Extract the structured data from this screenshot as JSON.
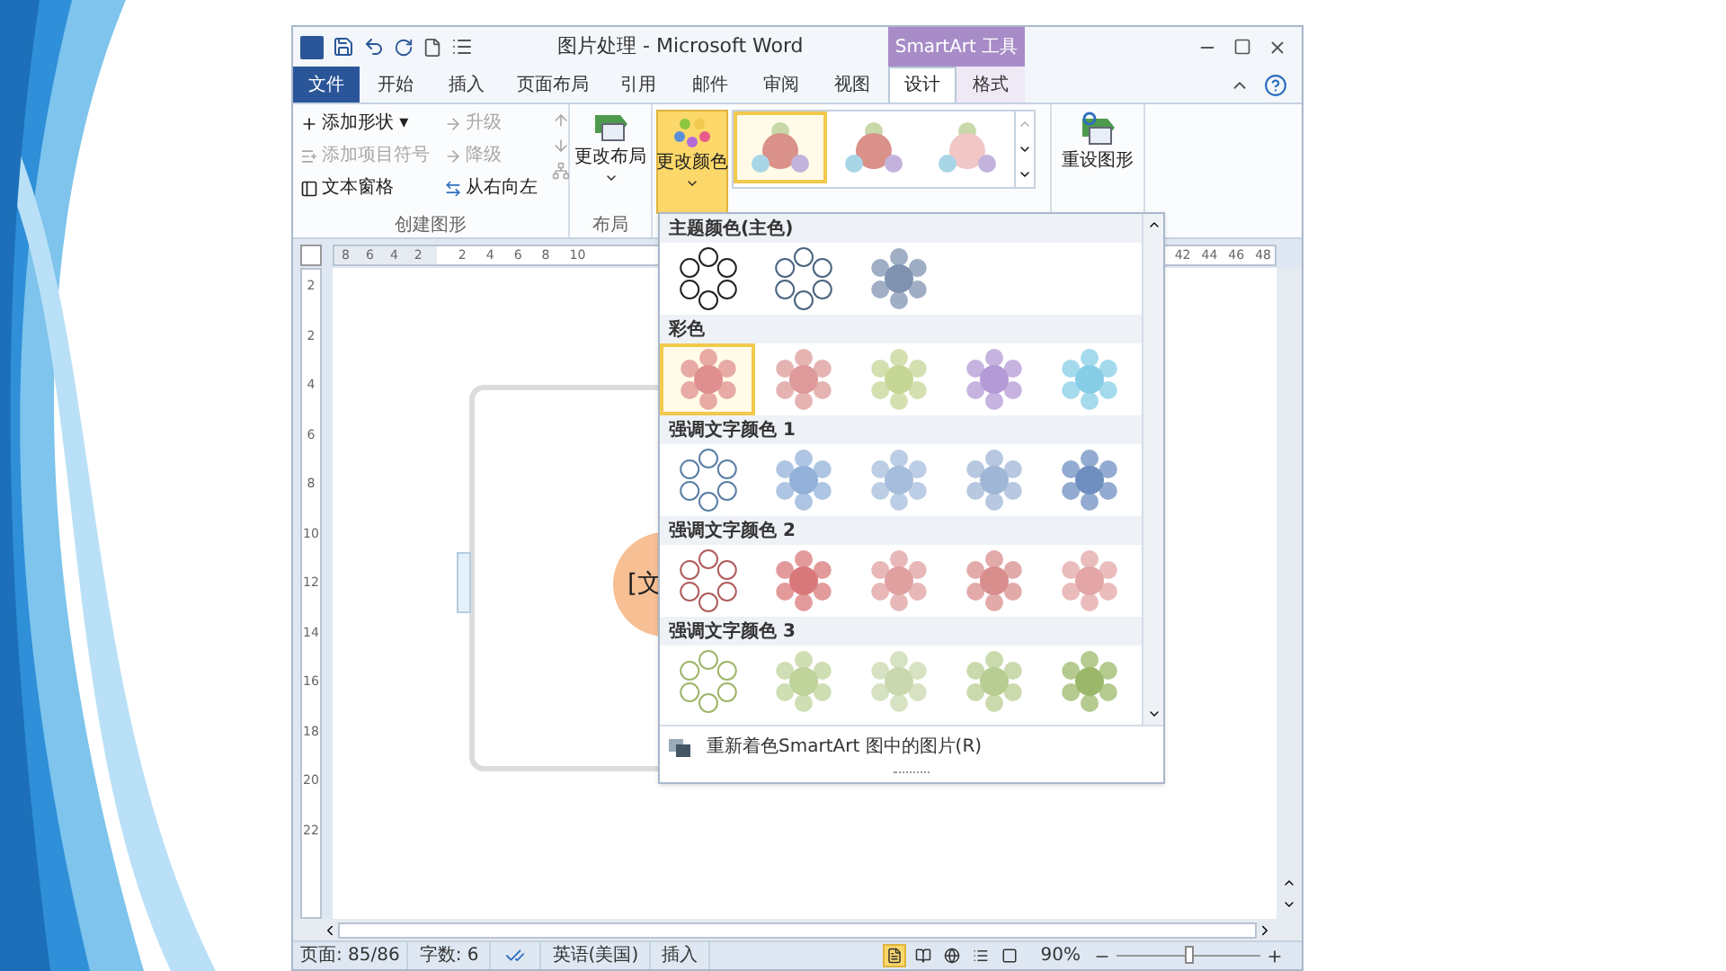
{
  "window": {
    "title": "图片处理 - Microsoft Word",
    "context_label": "SmartArt 工具"
  },
  "tabs": [
    {
      "label": "文件",
      "kind": "file",
      "selected": false
    },
    {
      "label": "开始",
      "kind": "tab",
      "selected": false
    },
    {
      "label": "插入",
      "kind": "tab",
      "selected": false
    },
    {
      "label": "页面布局",
      "kind": "tab",
      "selected": false
    },
    {
      "label": "引用",
      "kind": "tab",
      "selected": false
    },
    {
      "label": "邮件",
      "kind": "tab",
      "selected": false
    },
    {
      "label": "审阅",
      "kind": "tab",
      "selected": false
    },
    {
      "label": "视图",
      "kind": "tab",
      "selected": false
    },
    {
      "label": "设计",
      "kind": "context",
      "selected": true
    },
    {
      "label": "格式",
      "kind": "context",
      "selected": false
    }
  ],
  "ribbon": {
    "create_group": {
      "label": "创建图形",
      "left": [
        {
          "label": "添加形状 ▾",
          "disabled": false
        },
        {
          "label": "添加项目符号",
          "disabled": true
        },
        {
          "label": "文本窗格",
          "disabled": false
        }
      ],
      "right": [
        {
          "label": "升级",
          "disabled": true
        },
        {
          "label": "降级",
          "disabled": true
        },
        {
          "label": "从右向左",
          "disabled": false
        }
      ]
    },
    "layout_group": {
      "label": "布局",
      "button": "更改布局"
    },
    "change_colors": {
      "label": "更改颜色",
      "selected": true
    },
    "gallery": [
      {
        "selected": true
      },
      {
        "selected": false
      },
      {
        "selected": false
      }
    ],
    "reset": {
      "label": "重设图形"
    }
  },
  "ruler": {
    "left_labels": [
      "8",
      "6",
      "4",
      "2"
    ],
    "right_labels": [
      "2",
      "4",
      "6",
      "8",
      "10"
    ],
    "far_labels": [
      "42",
      "44",
      "46",
      "48"
    ],
    "vertical_labels": [
      "2",
      "2",
      "4",
      "6",
      "8",
      "10",
      "12",
      "14",
      "16",
      "18",
      "20",
      "22"
    ]
  },
  "document": {
    "shape_text": "[文"
  },
  "color_menu": {
    "sections": [
      {
        "title": "主题颜色(主色)",
        "variations": [
          {
            "kind": "outline",
            "color": "#222222",
            "selected": false
          },
          {
            "kind": "outline",
            "color": "#4a6480",
            "selected": false
          },
          {
            "kind": "fill",
            "color": "#7f93b0",
            "selected": false
          }
        ]
      },
      {
        "title": "彩色",
        "variations": [
          {
            "kind": "fill",
            "color": "#df8f8f",
            "selected": true
          },
          {
            "kind": "fill",
            "color": "#de9a9a",
            "selected": false
          },
          {
            "kind": "fill",
            "color": "#c6d695",
            "selected": false
          },
          {
            "kind": "fill",
            "color": "#b49ad6",
            "selected": false
          },
          {
            "kind": "fill",
            "color": "#86cde6",
            "selected": false
          }
        ]
      },
      {
        "title": "强调文字颜色 1",
        "variations": [
          {
            "kind": "outline",
            "color": "#5a7fa6",
            "selected": false
          },
          {
            "kind": "fill",
            "color": "#93b1d9",
            "selected": false
          },
          {
            "kind": "fill",
            "color": "#a6bddc",
            "selected": false
          },
          {
            "kind": "fill",
            "color": "#9fb6d6",
            "selected": false
          },
          {
            "kind": "fill",
            "color": "#6f8fc0",
            "selected": false
          }
        ]
      },
      {
        "title": "强调文字颜色 2",
        "variations": [
          {
            "kind": "outline",
            "color": "#b05c5c",
            "selected": false
          },
          {
            "kind": "fill",
            "color": "#d9787a",
            "selected": false
          },
          {
            "kind": "fill",
            "color": "#e0a0a0",
            "selected": false
          },
          {
            "kind": "fill",
            "color": "#d98e8e",
            "selected": false
          },
          {
            "kind": "fill",
            "color": "#e3a5a5",
            "selected": false
          }
        ]
      },
      {
        "title": "强调文字颜色 3",
        "variations": [
          {
            "kind": "outline",
            "color": "#9fb56a",
            "selected": false
          },
          {
            "kind": "fill",
            "color": "#bfd39a",
            "selected": false
          },
          {
            "kind": "fill",
            "color": "#c9d8ae",
            "selected": false
          },
          {
            "kind": "fill",
            "color": "#b8cd92",
            "selected": false
          },
          {
            "kind": "fill",
            "color": "#9bb86a",
            "selected": false
          }
        ]
      }
    ],
    "footer": "重新着色SmartArt 图中的图片(R)"
  },
  "status_bar": {
    "page": "页面: 85/86",
    "words": "字数: 6",
    "language": "英语(美国)",
    "mode": "插入",
    "zoom": "90%",
    "zoom_slider": {
      "level": 0.5
    },
    "views": [
      {
        "selected": true
      },
      {
        "selected": false
      },
      {
        "selected": false
      },
      {
        "selected": false
      },
      {
        "selected": false
      }
    ]
  }
}
